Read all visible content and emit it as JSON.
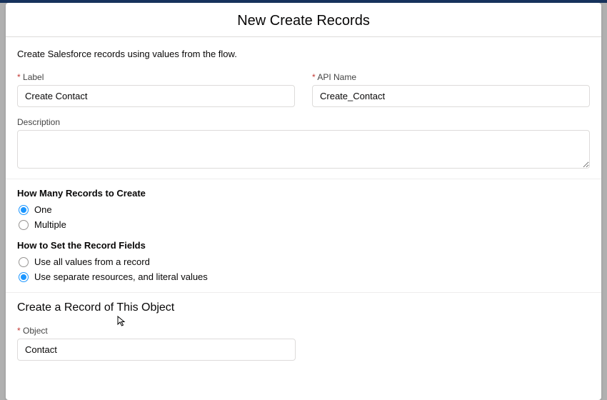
{
  "modal": {
    "title": "New Create Records"
  },
  "instruction": "Create Salesforce records using values from the flow.",
  "labels": {
    "label_field": "Label",
    "api_name_field": "API Name",
    "description_field": "Description",
    "how_many_heading": "How Many Records to Create",
    "how_set_heading": "How to Set the Record Fields",
    "create_record_heading": "Create a Record of This Object",
    "object_field": "Object"
  },
  "fields": {
    "label_value": "Create Contact",
    "api_name_value": "Create_Contact",
    "description_value": "",
    "object_value": "Contact"
  },
  "radio": {
    "how_many": {
      "selected": "one",
      "options": {
        "one": "One",
        "multiple": "Multiple"
      }
    },
    "how_set": {
      "selected": "separate",
      "options": {
        "record": "Use all values from a record",
        "separate": "Use separate resources, and literal values"
      }
    }
  }
}
